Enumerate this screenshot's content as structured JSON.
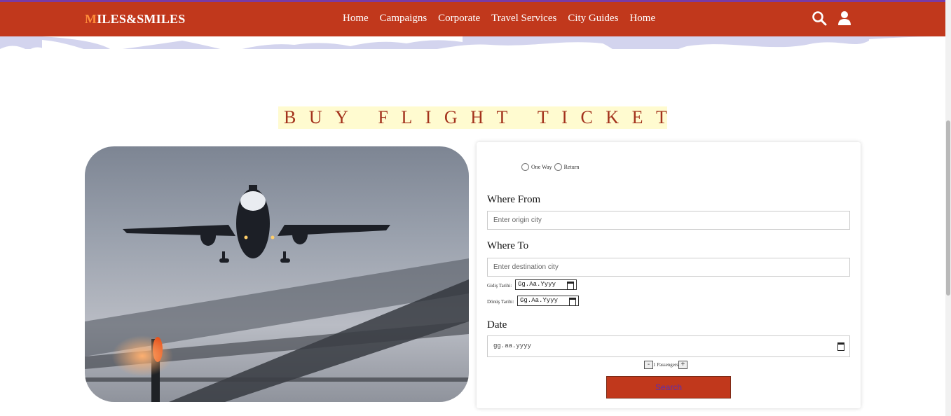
{
  "nav": {
    "logo_first": "M",
    "logo_rest": "ILES&SMILES",
    "links": [
      "Home",
      "Campaigns",
      "Corporate",
      "Travel Services",
      "City Guides",
      "Home"
    ]
  },
  "page": {
    "title": "BUY FLIGHT TICKETS"
  },
  "form": {
    "trip_one_way": "One Way",
    "trip_return": "Return",
    "from_label": "Where From",
    "from_placeholder": "Enter origin city",
    "to_label": "Where To",
    "to_placeholder": "Enter destination city",
    "departure_label": "Gidiş Tarihi:",
    "departure_value": "Gg.Aa.Yyyy",
    "return_label": "Dönüş Tarihi:",
    "return_value": "Gg.Aa.Yyyy",
    "date_label": "Date",
    "date_value": "gg.aa.yyyy",
    "passenger_minus": "-",
    "passenger_text": "1 Passengers",
    "passenger_plus": "+",
    "search_label": "Search"
  },
  "colors": {
    "brand": "#c1381c",
    "title_bg": "#fffbd0",
    "title_text": "#a3321c"
  },
  "icons": [
    "search-icon",
    "user-icon",
    "calendar-icon"
  ]
}
